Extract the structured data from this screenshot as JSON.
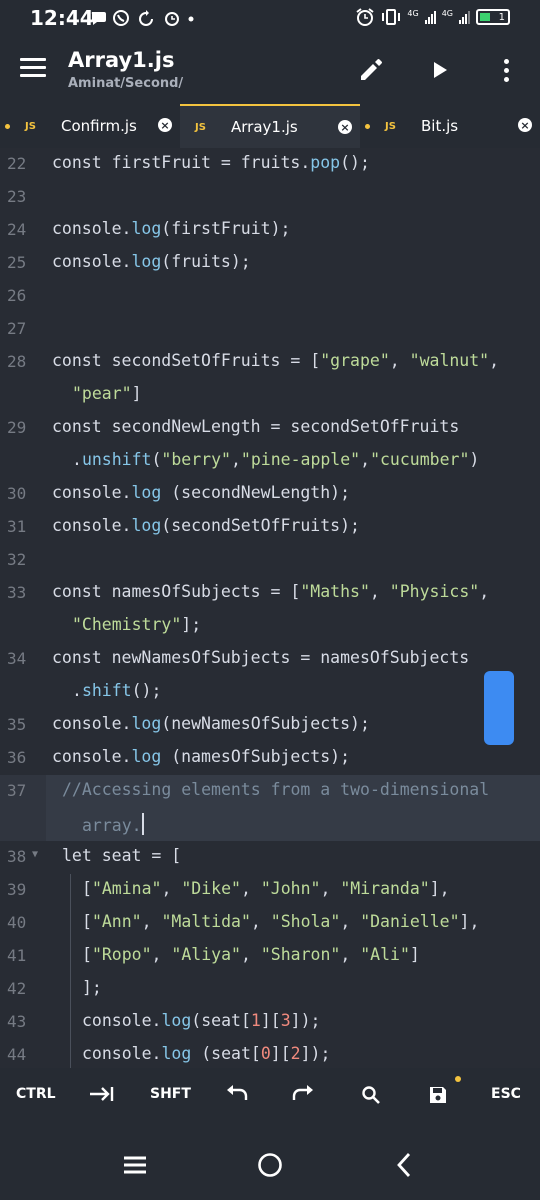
{
  "status_bar": {
    "time": "12:44",
    "battery_level": "1"
  },
  "app_bar": {
    "title": "Array1.js",
    "path": "Aminat/Second/"
  },
  "tabs": [
    {
      "label": "Confirm.js",
      "badge": "JS",
      "active": false,
      "modified": true
    },
    {
      "label": "Array1.js",
      "badge": "JS",
      "active": true,
      "modified": false
    },
    {
      "label": "Bit.js",
      "badge": "JS",
      "active": false,
      "modified": true
    }
  ],
  "editor": {
    "highlighted_line": "37",
    "lines": [
      {
        "n": "22",
        "ind": "",
        "tokens": [
          {
            "t": "const firstFruit = fruits.",
            "c": "plain"
          },
          {
            "t": "pop",
            "c": "fn"
          },
          {
            "t": "();",
            "c": "plain"
          }
        ]
      },
      {
        "n": "23",
        "ind": "",
        "tokens": []
      },
      {
        "n": "24",
        "ind": "",
        "tokens": [
          {
            "t": "console.",
            "c": "plain"
          },
          {
            "t": "log",
            "c": "fn"
          },
          {
            "t": "(firstFruit);",
            "c": "plain"
          }
        ]
      },
      {
        "n": "25",
        "ind": "",
        "tokens": [
          {
            "t": "console.",
            "c": "plain"
          },
          {
            "t": "log",
            "c": "fn"
          },
          {
            "t": "(fruits);",
            "c": "plain"
          }
        ]
      },
      {
        "n": "26",
        "ind": "",
        "tokens": []
      },
      {
        "n": "27",
        "ind": "",
        "tokens": []
      },
      {
        "n": "28",
        "ind": "",
        "tokens": [
          {
            "t": "const secondSetOfFruits = [",
            "c": "plain"
          },
          {
            "t": "\"grape\"",
            "c": "str"
          },
          {
            "t": ", ",
            "c": "plain"
          },
          {
            "t": "\"walnut\"",
            "c": "str"
          },
          {
            "t": ",",
            "c": "plain"
          }
        ]
      },
      {
        "n": "",
        "ind": "cont",
        "tokens": [
          {
            "t": "\"pear\"",
            "c": "str"
          },
          {
            "t": "]",
            "c": "plain"
          }
        ]
      },
      {
        "n": "29",
        "ind": "",
        "tokens": [
          {
            "t": "const secondNewLength = secondSetOfFruits",
            "c": "plain"
          }
        ]
      },
      {
        "n": "",
        "ind": "cont",
        "tokens": [
          {
            "t": ".",
            "c": "plain"
          },
          {
            "t": "unshift",
            "c": "fn"
          },
          {
            "t": "(",
            "c": "plain"
          },
          {
            "t": "\"berry\"",
            "c": "str"
          },
          {
            "t": ",",
            "c": "plain"
          },
          {
            "t": "\"pine-apple\"",
            "c": "str"
          },
          {
            "t": ",",
            "c": "plain"
          },
          {
            "t": "\"cucumber\"",
            "c": "str"
          },
          {
            "t": ")",
            "c": "plain"
          }
        ]
      },
      {
        "n": "30",
        "ind": "",
        "tokens": [
          {
            "t": "console.",
            "c": "plain"
          },
          {
            "t": "log",
            "c": "fn"
          },
          {
            "t": " (secondNewLength);",
            "c": "plain"
          }
        ]
      },
      {
        "n": "31",
        "ind": "",
        "tokens": [
          {
            "t": "console.",
            "c": "plain"
          },
          {
            "t": "log",
            "c": "fn"
          },
          {
            "t": "(secondSetOfFruits);",
            "c": "plain"
          }
        ]
      },
      {
        "n": "32",
        "ind": "",
        "tokens": []
      },
      {
        "n": "33",
        "ind": "",
        "tokens": [
          {
            "t": "const namesOfSubjects = [",
            "c": "plain"
          },
          {
            "t": "\"Maths\"",
            "c": "str"
          },
          {
            "t": ", ",
            "c": "plain"
          },
          {
            "t": "\"Physics\"",
            "c": "str"
          },
          {
            "t": ",",
            "c": "plain"
          }
        ]
      },
      {
        "n": "",
        "ind": "cont",
        "tokens": [
          {
            "t": "\"Chemistry\"",
            "c": "str"
          },
          {
            "t": "];",
            "c": "plain"
          }
        ]
      },
      {
        "n": "34",
        "ind": "",
        "tokens": [
          {
            "t": "const newNamesOfSubjects = namesOfSubjects",
            "c": "plain"
          }
        ]
      },
      {
        "n": "",
        "ind": "cont",
        "tokens": [
          {
            "t": ".",
            "c": "plain"
          },
          {
            "t": "shift",
            "c": "fn"
          },
          {
            "t": "();",
            "c": "plain"
          }
        ]
      },
      {
        "n": "35",
        "ind": "",
        "tokens": [
          {
            "t": "console.",
            "c": "plain"
          },
          {
            "t": "log",
            "c": "fn"
          },
          {
            "t": "(newNamesOfSubjects);",
            "c": "plain"
          }
        ]
      },
      {
        "n": "36",
        "ind": "",
        "tokens": [
          {
            "t": "console.",
            "c": "plain"
          },
          {
            "t": "log",
            "c": "fn"
          },
          {
            "t": " (namesOfSubjects);",
            "c": "plain"
          }
        ]
      },
      {
        "n": "37",
        "ind": "ind1",
        "hl": true,
        "tokens": [
          {
            "t": "//Accessing elements from a two-dimensional",
            "c": "cm"
          }
        ]
      },
      {
        "n": "",
        "ind": "ind1c",
        "hl": true,
        "caret": true,
        "tokens": [
          {
            "t": "array.",
            "c": "cm"
          }
        ]
      },
      {
        "n": "38",
        "ind": "ind1",
        "fold": true,
        "tokens": [
          {
            "t": "let seat = [",
            "c": "plain"
          }
        ]
      },
      {
        "n": "39",
        "ind": "ind2",
        "tokens": [
          {
            "t": "[",
            "c": "plain"
          },
          {
            "t": "\"Amina\"",
            "c": "str"
          },
          {
            "t": ", ",
            "c": "plain"
          },
          {
            "t": "\"Dike\"",
            "c": "str"
          },
          {
            "t": ", ",
            "c": "plain"
          },
          {
            "t": "\"John\"",
            "c": "str"
          },
          {
            "t": ", ",
            "c": "plain"
          },
          {
            "t": "\"Miranda\"",
            "c": "str"
          },
          {
            "t": "],",
            "c": "plain"
          }
        ]
      },
      {
        "n": "40",
        "ind": "ind2",
        "tokens": [
          {
            "t": "[",
            "c": "plain"
          },
          {
            "t": "\"Ann\"",
            "c": "str"
          },
          {
            "t": ", ",
            "c": "plain"
          },
          {
            "t": "\"Maltida\"",
            "c": "str"
          },
          {
            "t": ", ",
            "c": "plain"
          },
          {
            "t": "\"Shola\"",
            "c": "str"
          },
          {
            "t": ", ",
            "c": "plain"
          },
          {
            "t": "\"Danielle\"",
            "c": "str"
          },
          {
            "t": "],",
            "c": "plain"
          }
        ]
      },
      {
        "n": "41",
        "ind": "ind2",
        "tokens": [
          {
            "t": "[",
            "c": "plain"
          },
          {
            "t": "\"Ropo\"",
            "c": "str"
          },
          {
            "t": ", ",
            "c": "plain"
          },
          {
            "t": "\"Aliya\"",
            "c": "str"
          },
          {
            "t": ", ",
            "c": "plain"
          },
          {
            "t": "\"Sharon\"",
            "c": "str"
          },
          {
            "t": ", ",
            "c": "plain"
          },
          {
            "t": "\"Ali\"",
            "c": "str"
          },
          {
            "t": "]",
            "c": "plain"
          }
        ]
      },
      {
        "n": "42",
        "ind": "ind2",
        "tokens": [
          {
            "t": "];",
            "c": "plain"
          }
        ]
      },
      {
        "n": "43",
        "ind": "ind2",
        "tokens": [
          {
            "t": "console.",
            "c": "plain"
          },
          {
            "t": "log",
            "c": "fn"
          },
          {
            "t": "(seat[",
            "c": "plain"
          },
          {
            "t": "1",
            "c": "num"
          },
          {
            "t": "][",
            "c": "plain"
          },
          {
            "t": "3",
            "c": "num"
          },
          {
            "t": "]);",
            "c": "plain"
          }
        ]
      },
      {
        "n": "44",
        "ind": "ind2",
        "tokens": [
          {
            "t": "console.",
            "c": "plain"
          },
          {
            "t": "log",
            "c": "fn"
          },
          {
            "t": " (seat[",
            "c": "plain"
          },
          {
            "t": "0",
            "c": "num"
          },
          {
            "t": "][",
            "c": "plain"
          },
          {
            "t": "2",
            "c": "num"
          },
          {
            "t": "]);",
            "c": "plain"
          }
        ]
      }
    ]
  },
  "toolbar": {
    "ctrl": "CTRL",
    "shift": "SHFT",
    "esc": "ESC",
    "icons": [
      "tab-icon",
      "undo-icon",
      "redo-icon",
      "search-icon",
      "save-icon"
    ]
  },
  "colors": {
    "background": "#282c34",
    "accent": "#f3c33f",
    "string": "#bedb9a",
    "function": "#86c6e8",
    "number": "#f08a7e",
    "comment": "#7a8b9c",
    "scroll_thumb": "#3d8bf2"
  }
}
